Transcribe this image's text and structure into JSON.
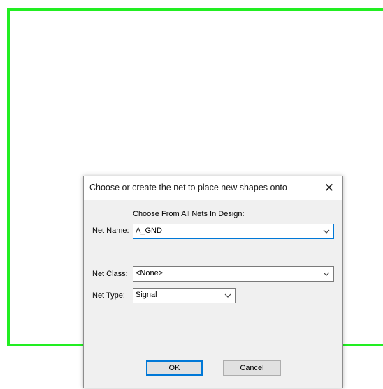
{
  "colors": {
    "shape_outline": "#22ee22",
    "dialog_bg": "#f0f0f0",
    "focus_blue": "#0078d7"
  },
  "dialog": {
    "title": "Choose or create the net to place new shapes onto",
    "close_icon": "close-icon",
    "choose_label": "Choose From All Nets In Design:",
    "net_name_label": "Net Name:",
    "net_name_value": "A_GND",
    "net_class_label": "Net Class:",
    "net_class_value": "<None>",
    "net_type_label": "Net Type:",
    "net_type_value": "Signal",
    "ok_label": "OK",
    "cancel_label": "Cancel"
  }
}
